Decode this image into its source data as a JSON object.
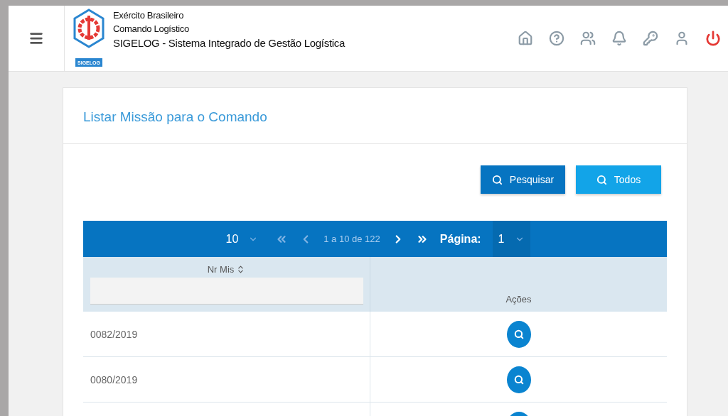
{
  "header": {
    "org_lines": [
      "Exército Brasileiro",
      "Comando Logístico",
      "SIGELOG - Sistema Integrado de Gestão Logística"
    ],
    "logo_caption": "SIGELOG"
  },
  "page_title": "Listar Missão para o Comando",
  "buttons": [
    {
      "label": "Pesquisar",
      "kind": "primary"
    },
    {
      "label": "Todos",
      "kind": "secondary"
    }
  ],
  "pager": {
    "page_size": "10",
    "range": "1 a 10 de 122",
    "page_label": "Página:",
    "page": "1"
  },
  "table": {
    "columns": [
      {
        "label": "Nr Mis",
        "sortable": true,
        "filter": true
      },
      {
        "label": "Ações",
        "sortable": false,
        "filter": false
      }
    ],
    "rows": [
      {
        "number": "0082/2019"
      },
      {
        "number": "0080/2019"
      },
      {}
    ]
  }
}
